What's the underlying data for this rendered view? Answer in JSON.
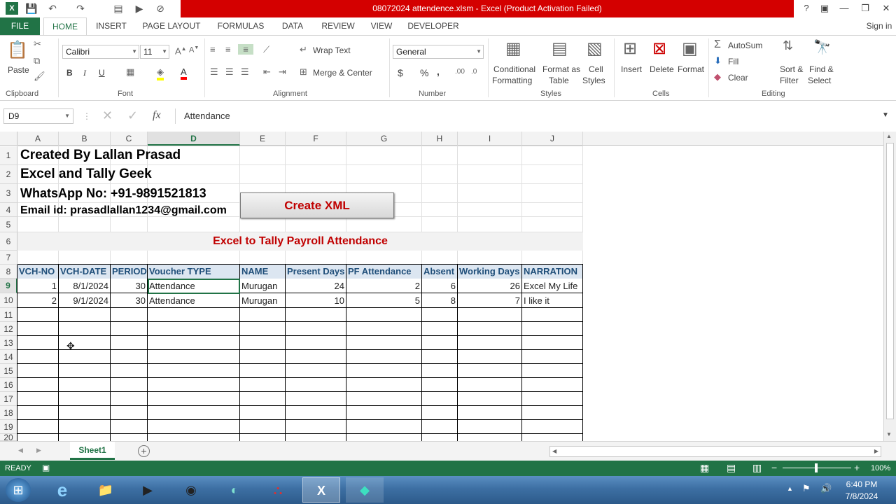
{
  "window": {
    "title": "08072024 attendence.xlsm - Excel (Product Activation Failed)",
    "controls": [
      "?",
      "▣",
      "—",
      "❐",
      "✕"
    ]
  },
  "tabs": [
    "FILE",
    "HOME",
    "INSERT",
    "PAGE LAYOUT",
    "FORMULAS",
    "DATA",
    "REVIEW",
    "VIEW",
    "DEVELOPER"
  ],
  "sign_in": "Sign in",
  "ribbon": {
    "clipboard": {
      "paste": "Paste",
      "label": "Clipboard"
    },
    "font": {
      "name": "Calibri",
      "size": "11",
      "label": "Font",
      "bold": "B",
      "italic": "I",
      "underline": "U"
    },
    "alignment": {
      "wrap": "Wrap Text",
      "merge": "Merge & Center",
      "label": "Alignment"
    },
    "number": {
      "format": "General",
      "label": "Number",
      "currency": "$",
      "percent": "%",
      "comma": ","
    },
    "styles": {
      "cond1": "Conditional",
      "cond2": "Formatting",
      "fmt1": "Format as",
      "fmt2": "Table",
      "cell1": "Cell",
      "cell2": "Styles",
      "label": "Styles"
    },
    "cells": {
      "insert": "Insert",
      "delete": "Delete",
      "format": "Format",
      "label": "Cells"
    },
    "editing": {
      "autosum": "AutoSum",
      "fill": "Fill",
      "clear": "Clear",
      "sort1": "Sort &",
      "sort2": "Filter",
      "find1": "Find &",
      "find2": "Select",
      "label": "Editing"
    }
  },
  "formula_bar": {
    "name_box": "D9",
    "fx": "fx",
    "content": "Attendance"
  },
  "columns": [
    "A",
    "B",
    "C",
    "D",
    "E",
    "F",
    "G",
    "H",
    "I",
    "J"
  ],
  "rows": [
    "1",
    "2",
    "3",
    "4",
    "5",
    "6",
    "7",
    "8",
    "9",
    "10",
    "11",
    "12",
    "13",
    "14",
    "15",
    "16",
    "17",
    "18",
    "19",
    "20"
  ],
  "sheet": {
    "info": [
      "Created By Lallan Prasad",
      "Excel and Tally Geek",
      "WhatsApp No: +91-9891521813",
      "Email id: prasadlallan1234@gmail.com"
    ],
    "button": "Create XML",
    "banner": "Excel to Tally Payroll Attendance",
    "headers": [
      "VCH-NO",
      "VCH-DATE",
      "PERIOD",
      "Voucher TYPE",
      "NAME",
      "Present Days",
      "PF Attendance",
      "Absent",
      "Working Days",
      "NARRATION"
    ],
    "data": [
      [
        "1",
        "8/1/2024",
        "30",
        "Attendance",
        "Murugan",
        "24",
        "2",
        "6",
        "26",
        "Excel My Life"
      ],
      [
        "2",
        "9/1/2024",
        "30",
        "Attendance",
        "Murugan",
        "10",
        "5",
        "8",
        "7",
        "I like it"
      ]
    ]
  },
  "sheet_tab": "Sheet1",
  "status": {
    "ready": "READY",
    "zoom": "100%"
  },
  "clock": {
    "time": "6:40 PM",
    "date": "7/8/2024"
  },
  "colors": {
    "excel_green": "#217346",
    "title_red": "#d40000",
    "header_fill": "#dce6f1",
    "banner_text": "#c00000"
  }
}
